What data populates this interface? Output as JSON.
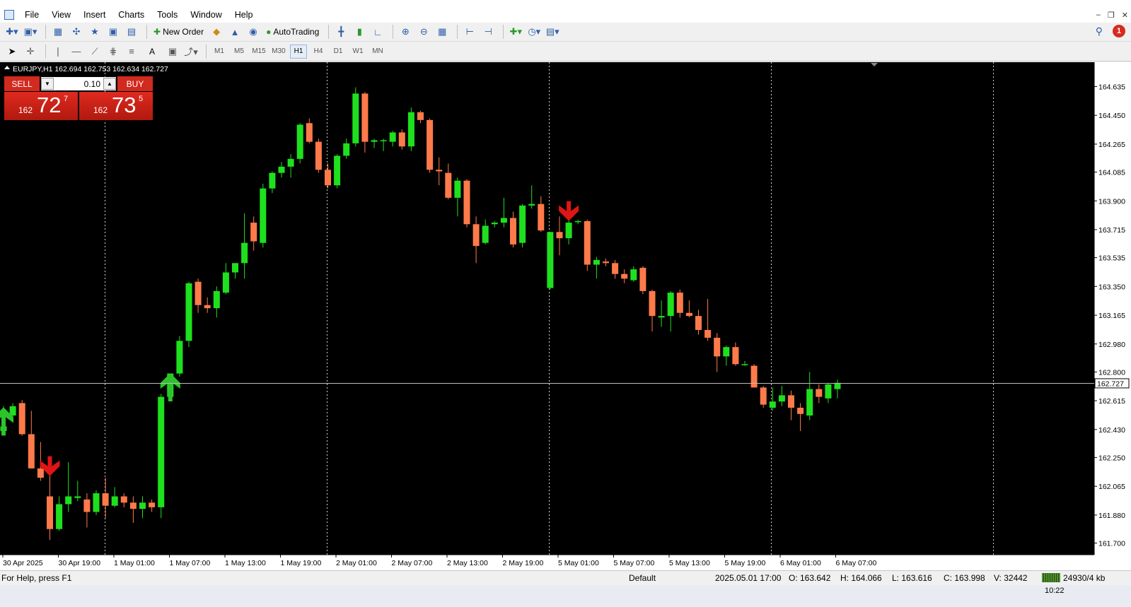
{
  "menu": {
    "items": [
      "File",
      "View",
      "Insert",
      "Charts",
      "Tools",
      "Window",
      "Help"
    ]
  },
  "toolbar": {
    "new_order_label": "New Order",
    "autotrading_label": "AutoTrading",
    "timeframes": [
      "M1",
      "M5",
      "M15",
      "M30",
      "H1",
      "H4",
      "D1",
      "W1",
      "MN"
    ],
    "active_timeframe": "H1",
    "text_tool_label": "A",
    "alert_count": "1"
  },
  "chart": {
    "symbol_line": "EURJPY,H1  162.694 162.753 162.634 162.727",
    "current_price_label": "162.727",
    "price_ticks": [
      "164.635",
      "164.450",
      "164.265",
      "164.085",
      "163.900",
      "163.715",
      "163.535",
      "163.350",
      "163.165",
      "162.980",
      "162.800",
      "162.615",
      "162.430",
      "162.250",
      "162.065",
      "161.880",
      "161.700"
    ],
    "time_labels": [
      "30 Apr 2025",
      "30 Apr 19:00",
      "1 May 01:00",
      "1 May 07:00",
      "1 May 13:00",
      "1 May 19:00",
      "2 May 01:00",
      "2 May 07:00",
      "2 May 13:00",
      "2 May 19:00",
      "5 May 01:00",
      "5 May 07:00",
      "5 May 13:00",
      "5 May 19:00",
      "6 May 01:00",
      "6 May 07:00"
    ],
    "colors": {
      "background": "#000000",
      "bull": "#1ee01e",
      "bear": "#ff7a4a",
      "arrow_up": "#2bc42b",
      "arrow_down": "#e01515",
      "grid": "#cfcfcf"
    }
  },
  "one_click": {
    "sell_label": "SELL",
    "buy_label": "BUY",
    "lot": "0.10",
    "sell_price": {
      "small": "162",
      "big": "72",
      "sup": "7"
    },
    "buy_price": {
      "small": "162",
      "big": "73",
      "sup": "5"
    }
  },
  "status": {
    "help": "For Help, press F1",
    "profile": "Default",
    "datetime": "2025.05.01 17:00",
    "open": "O: 163.642",
    "high": "H: 164.066",
    "low": "L: 163.616",
    "close": "C: 163.998",
    "volume": "V: 32442",
    "traffic": "24930/4 kb"
  },
  "taskbar": {
    "clock": "10:22"
  },
  "chart_data": {
    "type": "candlestick",
    "title": "EURJPY,H1",
    "xlabel": "",
    "ylabel": "",
    "ylim": [
      161.62,
      164.74
    ],
    "grid": true,
    "candles": [
      {
        "o": 162.42,
        "h": 162.58,
        "l": 162.4,
        "c": 162.45
      },
      {
        "o": 162.52,
        "h": 162.6,
        "l": 162.5,
        "c": 162.58
      },
      {
        "o": 162.6,
        "h": 162.62,
        "l": 162.39,
        "c": 162.4
      },
      {
        "o": 162.4,
        "h": 162.55,
        "l": 162.18,
        "c": 162.18
      },
      {
        "o": 162.18,
        "h": 162.35,
        "l": 162.1,
        "c": 162.12
      },
      {
        "o": 162.0,
        "h": 162.14,
        "l": 161.72,
        "c": 161.79
      },
      {
        "o": 161.79,
        "h": 162.0,
        "l": 161.78,
        "c": 161.95
      },
      {
        "o": 161.95,
        "h": 162.22,
        "l": 161.9,
        "c": 162.0
      },
      {
        "o": 161.99,
        "h": 162.1,
        "l": 161.97,
        "c": 162.0
      },
      {
        "o": 161.98,
        "h": 162.02,
        "l": 161.8,
        "c": 161.9
      },
      {
        "o": 161.9,
        "h": 162.04,
        "l": 161.88,
        "c": 162.02
      },
      {
        "o": 162.02,
        "h": 162.12,
        "l": 161.86,
        "c": 161.94
      },
      {
        "o": 161.94,
        "h": 162.06,
        "l": 161.93,
        "c": 162.0
      },
      {
        "o": 162.0,
        "h": 162.02,
        "l": 161.93,
        "c": 161.96
      },
      {
        "o": 161.96,
        "h": 162.0,
        "l": 161.83,
        "c": 161.92
      },
      {
        "o": 161.92,
        "h": 162.0,
        "l": 161.86,
        "c": 161.96
      },
      {
        "o": 161.96,
        "h": 161.98,
        "l": 161.9,
        "c": 161.93
      },
      {
        "o": 161.93,
        "h": 162.66,
        "l": 161.86,
        "c": 162.64
      },
      {
        "o": 162.64,
        "h": 162.76,
        "l": 162.62,
        "c": 162.79
      },
      {
        "o": 162.79,
        "h": 163.03,
        "l": 162.77,
        "c": 163.0
      },
      {
        "o": 163.0,
        "h": 163.38,
        "l": 162.96,
        "c": 163.37
      },
      {
        "o": 163.38,
        "h": 163.4,
        "l": 163.18,
        "c": 163.23
      },
      {
        "o": 163.23,
        "h": 163.28,
        "l": 163.18,
        "c": 163.21
      },
      {
        "o": 163.21,
        "h": 163.35,
        "l": 163.15,
        "c": 163.32
      },
      {
        "o": 163.31,
        "h": 163.5,
        "l": 163.3,
        "c": 163.44
      },
      {
        "o": 163.44,
        "h": 163.5,
        "l": 163.4,
        "c": 163.5
      },
      {
        "o": 163.5,
        "h": 163.82,
        "l": 163.4,
        "c": 163.63
      },
      {
        "o": 163.76,
        "h": 163.8,
        "l": 163.58,
        "c": 163.64
      },
      {
        "o": 163.63,
        "h": 164.01,
        "l": 163.6,
        "c": 163.98
      },
      {
        "o": 163.98,
        "h": 164.09,
        "l": 163.95,
        "c": 164.08
      },
      {
        "o": 164.08,
        "h": 164.15,
        "l": 164.05,
        "c": 164.12
      },
      {
        "o": 164.12,
        "h": 164.2,
        "l": 164.05,
        "c": 164.17
      },
      {
        "o": 164.17,
        "h": 164.4,
        "l": 164.14,
        "c": 164.39
      },
      {
        "o": 164.4,
        "h": 164.43,
        "l": 164.27,
        "c": 164.28
      },
      {
        "o": 164.28,
        "h": 164.3,
        "l": 164.08,
        "c": 164.1
      },
      {
        "o": 164.1,
        "h": 164.14,
        "l": 163.98,
        "c": 164.0
      },
      {
        "o": 164.0,
        "h": 164.2,
        "l": 163.98,
        "c": 164.19
      },
      {
        "o": 164.19,
        "h": 164.3,
        "l": 164.17,
        "c": 164.27
      },
      {
        "o": 164.27,
        "h": 164.63,
        "l": 164.25,
        "c": 164.59
      },
      {
        "o": 164.59,
        "h": 164.6,
        "l": 164.21,
        "c": 164.28
      },
      {
        "o": 164.28,
        "h": 164.3,
        "l": 164.24,
        "c": 164.29
      },
      {
        "o": 164.29,
        "h": 164.3,
        "l": 164.22,
        "c": 164.29
      },
      {
        "o": 164.28,
        "h": 164.35,
        "l": 164.25,
        "c": 164.34
      },
      {
        "o": 164.34,
        "h": 164.36,
        "l": 164.23,
        "c": 164.25
      },
      {
        "o": 164.25,
        "h": 164.5,
        "l": 164.22,
        "c": 164.47
      },
      {
        "o": 164.47,
        "h": 164.48,
        "l": 164.4,
        "c": 164.42
      },
      {
        "o": 164.42,
        "h": 164.43,
        "l": 164.08,
        "c": 164.1
      },
      {
        "o": 164.1,
        "h": 164.18,
        "l": 164.0,
        "c": 164.09
      },
      {
        "o": 164.08,
        "h": 164.14,
        "l": 163.91,
        "c": 163.92
      },
      {
        "o": 163.92,
        "h": 164.05,
        "l": 163.8,
        "c": 164.03
      },
      {
        "o": 164.03,
        "h": 164.04,
        "l": 163.73,
        "c": 163.75
      },
      {
        "o": 163.75,
        "h": 163.8,
        "l": 163.5,
        "c": 163.61
      },
      {
        "o": 163.63,
        "h": 163.78,
        "l": 163.62,
        "c": 163.74
      },
      {
        "o": 163.75,
        "h": 163.77,
        "l": 163.73,
        "c": 163.76
      },
      {
        "o": 163.76,
        "h": 163.92,
        "l": 163.73,
        "c": 163.79
      },
      {
        "o": 163.79,
        "h": 163.83,
        "l": 163.6,
        "c": 163.62
      },
      {
        "o": 163.63,
        "h": 163.88,
        "l": 163.6,
        "c": 163.87
      },
      {
        "o": 163.87,
        "h": 164.0,
        "l": 163.85,
        "c": 163.88
      },
      {
        "o": 163.88,
        "h": 163.93,
        "l": 163.7,
        "c": 163.71
      },
      {
        "o": 163.34,
        "h": 163.7,
        "l": 163.33,
        "c": 163.7
      },
      {
        "o": 163.7,
        "h": 163.8,
        "l": 163.55,
        "c": 163.66
      },
      {
        "o": 163.66,
        "h": 163.78,
        "l": 163.62,
        "c": 163.76
      },
      {
        "o": 163.77,
        "h": 163.78,
        "l": 163.75,
        "c": 163.77
      },
      {
        "o": 163.77,
        "h": 163.78,
        "l": 163.45,
        "c": 163.49
      },
      {
        "o": 163.49,
        "h": 163.54,
        "l": 163.4,
        "c": 163.52
      },
      {
        "o": 163.51,
        "h": 163.53,
        "l": 163.48,
        "c": 163.5
      },
      {
        "o": 163.5,
        "h": 163.52,
        "l": 163.4,
        "c": 163.43
      },
      {
        "o": 163.43,
        "h": 163.46,
        "l": 163.37,
        "c": 163.4
      },
      {
        "o": 163.39,
        "h": 163.48,
        "l": 163.38,
        "c": 163.46
      },
      {
        "o": 163.47,
        "h": 163.48,
        "l": 163.3,
        "c": 163.32
      },
      {
        "o": 163.32,
        "h": 163.33,
        "l": 163.06,
        "c": 163.16
      },
      {
        "o": 163.15,
        "h": 163.26,
        "l": 163.09,
        "c": 163.16
      },
      {
        "o": 163.16,
        "h": 163.32,
        "l": 163.06,
        "c": 163.31
      },
      {
        "o": 163.31,
        "h": 163.33,
        "l": 163.15,
        "c": 163.18
      },
      {
        "o": 163.18,
        "h": 163.26,
        "l": 163.15,
        "c": 163.16
      },
      {
        "o": 163.16,
        "h": 163.2,
        "l": 163.04,
        "c": 163.07
      },
      {
        "o": 163.07,
        "h": 163.27,
        "l": 163.0,
        "c": 163.02
      },
      {
        "o": 163.02,
        "h": 163.05,
        "l": 162.8,
        "c": 162.9
      },
      {
        "o": 162.9,
        "h": 162.97,
        "l": 162.84,
        "c": 162.96
      },
      {
        "o": 162.96,
        "h": 162.99,
        "l": 162.84,
        "c": 162.85
      },
      {
        "o": 162.85,
        "h": 162.87,
        "l": 162.84,
        "c": 162.85
      },
      {
        "o": 162.84,
        "h": 162.85,
        "l": 162.7,
        "c": 162.7
      },
      {
        "o": 162.7,
        "h": 162.71,
        "l": 162.57,
        "c": 162.59
      },
      {
        "o": 162.57,
        "h": 162.7,
        "l": 162.55,
        "c": 162.61
      },
      {
        "o": 162.61,
        "h": 162.71,
        "l": 162.58,
        "c": 162.65
      },
      {
        "o": 162.65,
        "h": 162.68,
        "l": 162.49,
        "c": 162.57
      },
      {
        "o": 162.57,
        "h": 162.6,
        "l": 162.42,
        "c": 162.53
      },
      {
        "o": 162.52,
        "h": 162.8,
        "l": 162.49,
        "c": 162.69
      },
      {
        "o": 162.69,
        "h": 162.72,
        "l": 162.6,
        "c": 162.64
      },
      {
        "o": 162.63,
        "h": 162.73,
        "l": 162.6,
        "c": 162.72
      },
      {
        "o": 162.69,
        "h": 162.75,
        "l": 162.63,
        "c": 162.73
      }
    ],
    "signals": [
      {
        "candle": 0,
        "dir": "up"
      },
      {
        "candle": 5,
        "dir": "down"
      },
      {
        "candle": 18,
        "dir": "up"
      },
      {
        "candle": 61,
        "dir": "down"
      }
    ]
  }
}
